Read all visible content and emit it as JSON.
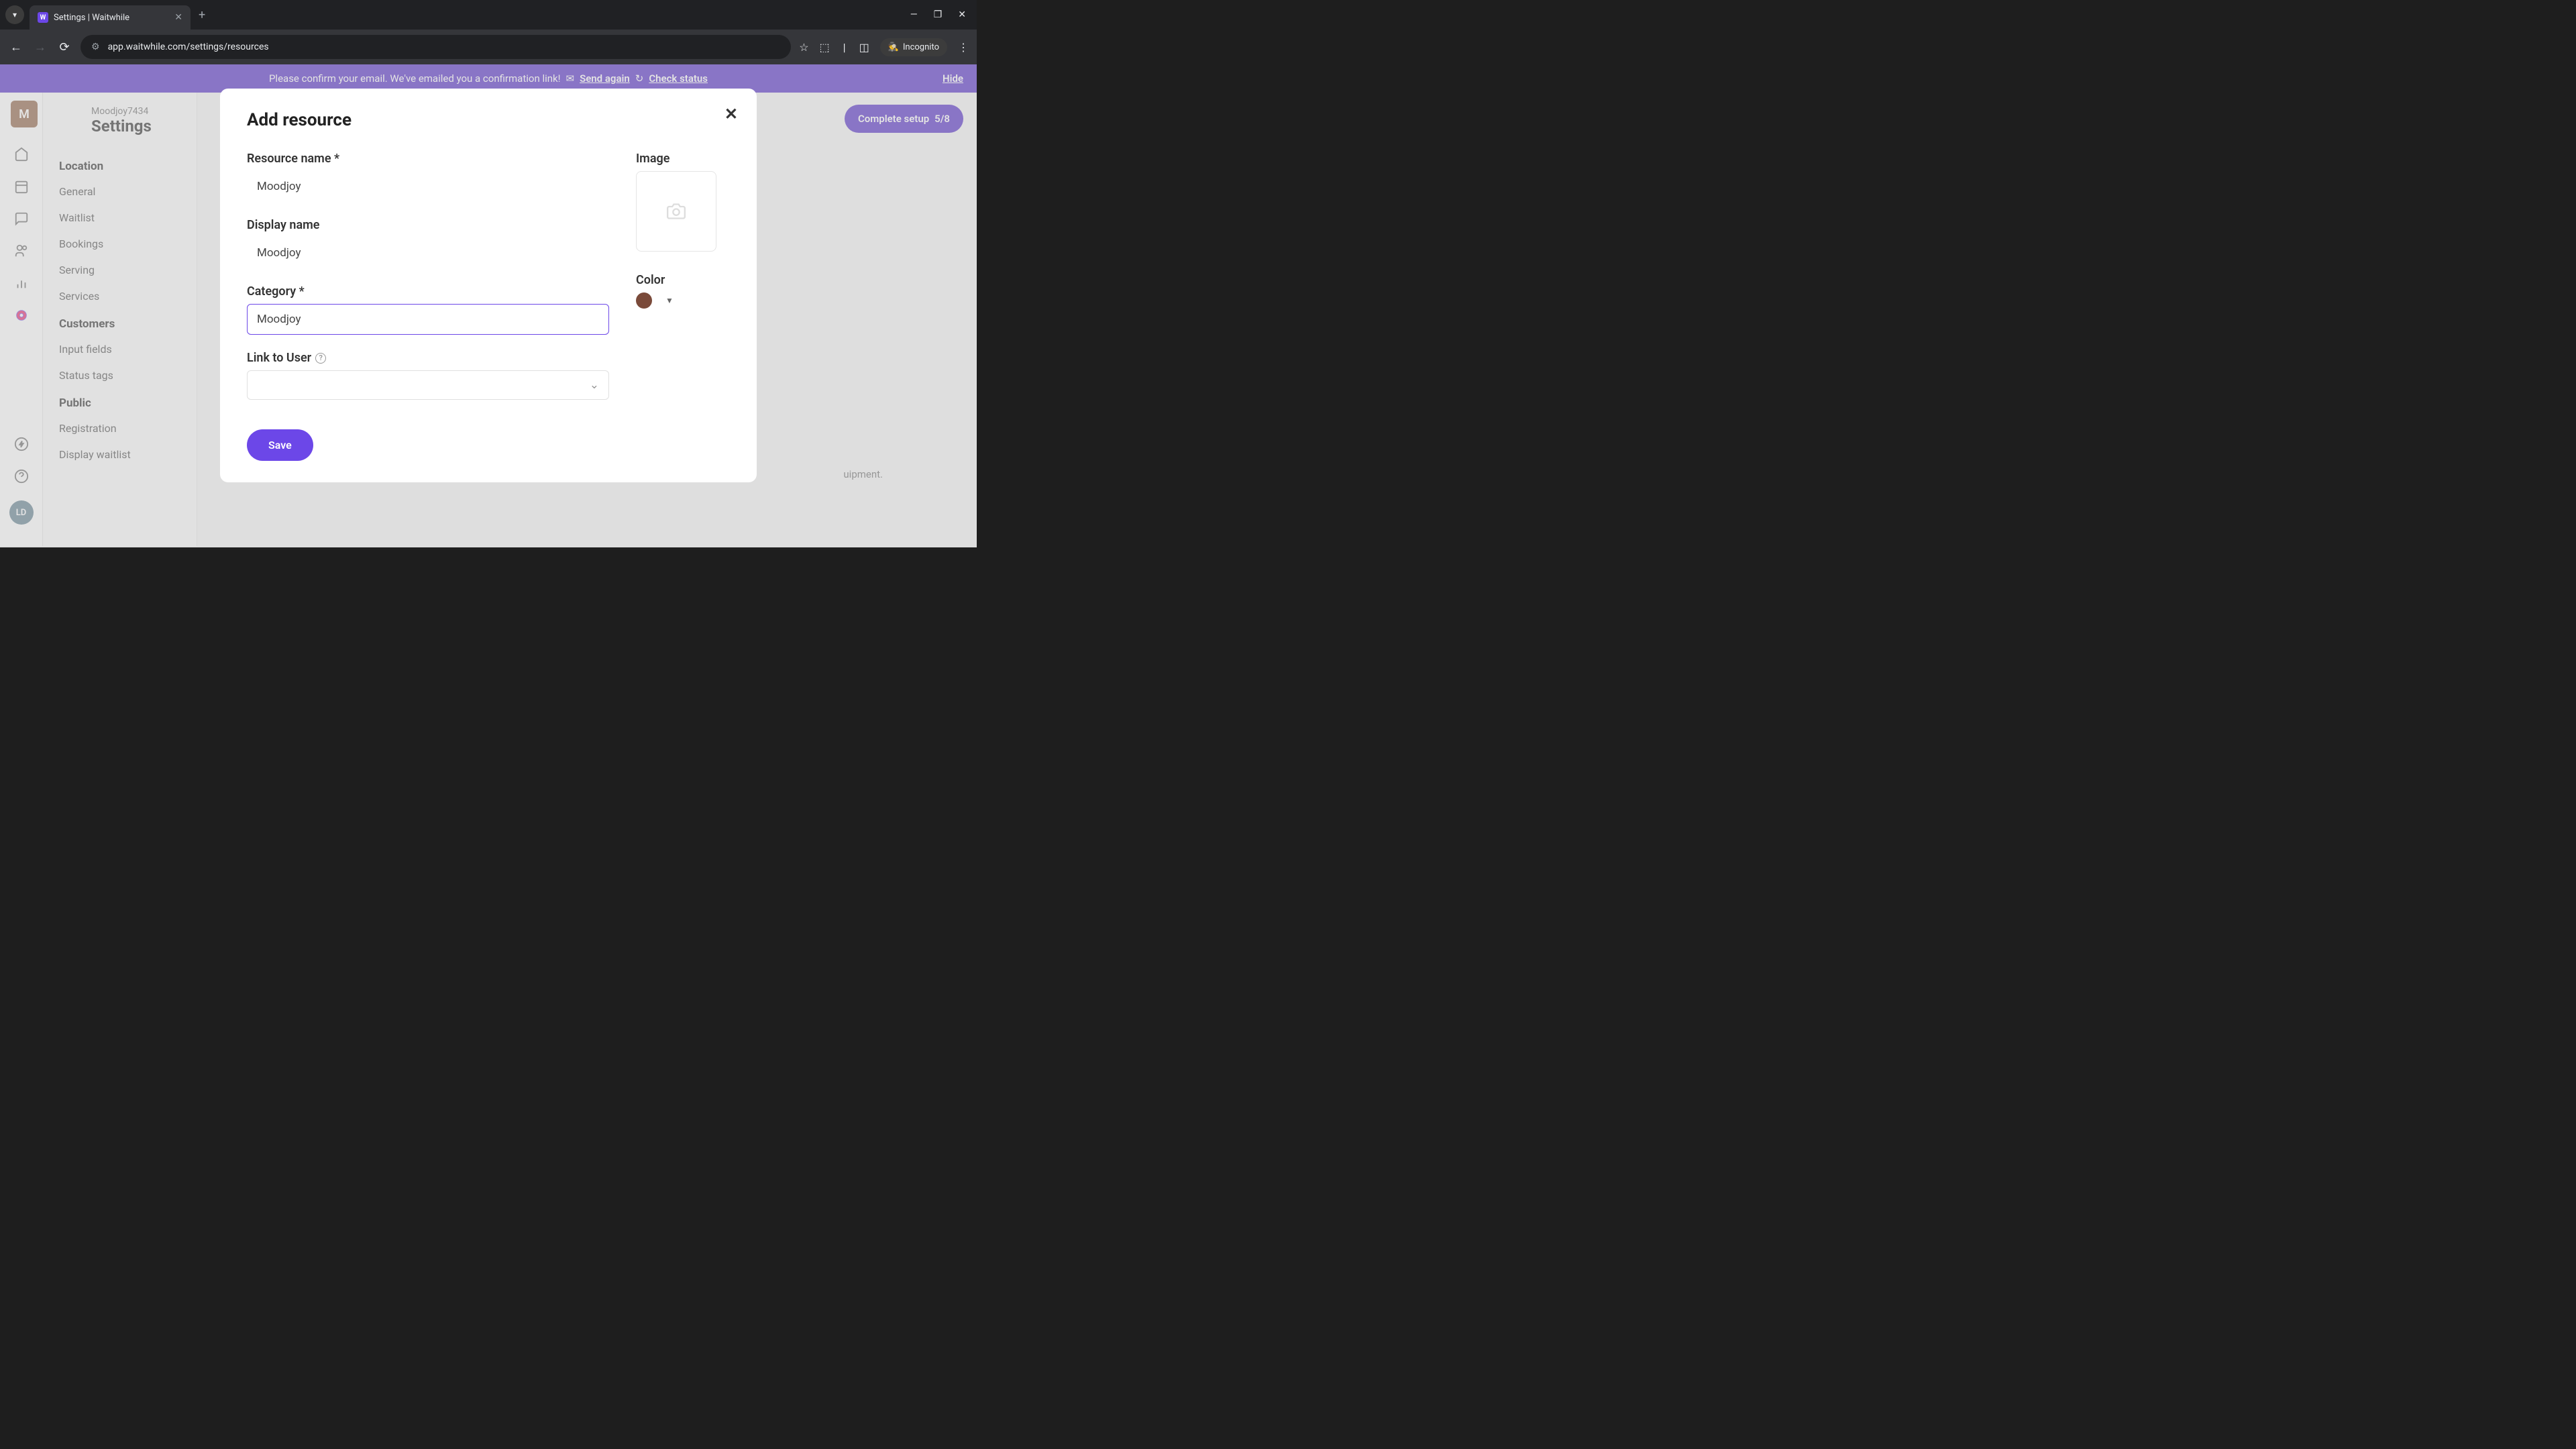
{
  "browser": {
    "tab_title": "Settings | Waitwhile",
    "url": "app.waitwhile.com/settings/resources",
    "incognito_label": "Incognito"
  },
  "banner": {
    "text": "Please confirm your email. We've emailed you a confirmation link!",
    "send_again": "Send again",
    "check_status": "Check status",
    "hide": "Hide"
  },
  "header": {
    "org_avatar": "M",
    "org_name": "Moodjoy7434",
    "page_title": "Settings",
    "complete_setup": "Complete setup",
    "complete_progress": "5/8"
  },
  "sidebar": {
    "sections": [
      {
        "title": "Location",
        "items": [
          "General",
          "Waitlist",
          "Bookings",
          "Serving",
          "Services"
        ]
      },
      {
        "title": "Customers",
        "items": [
          "Input fields",
          "Status tags"
        ]
      },
      {
        "title": "Public",
        "items": [
          "Registration",
          "Display waitlist"
        ]
      }
    ]
  },
  "user_avatar": "LD",
  "modal": {
    "title": "Add resource",
    "resource_name_label": "Resource name *",
    "resource_name_value": "Moodjoy",
    "display_name_label": "Display name",
    "display_name_value": "Moodjoy",
    "category_label": "Category *",
    "category_value": "Moodjoy",
    "link_user_label": "Link to User",
    "image_label": "Image",
    "color_label": "Color",
    "color_value": "#7a4a3a",
    "save_button": "Save"
  },
  "partial_visible": "uipment."
}
